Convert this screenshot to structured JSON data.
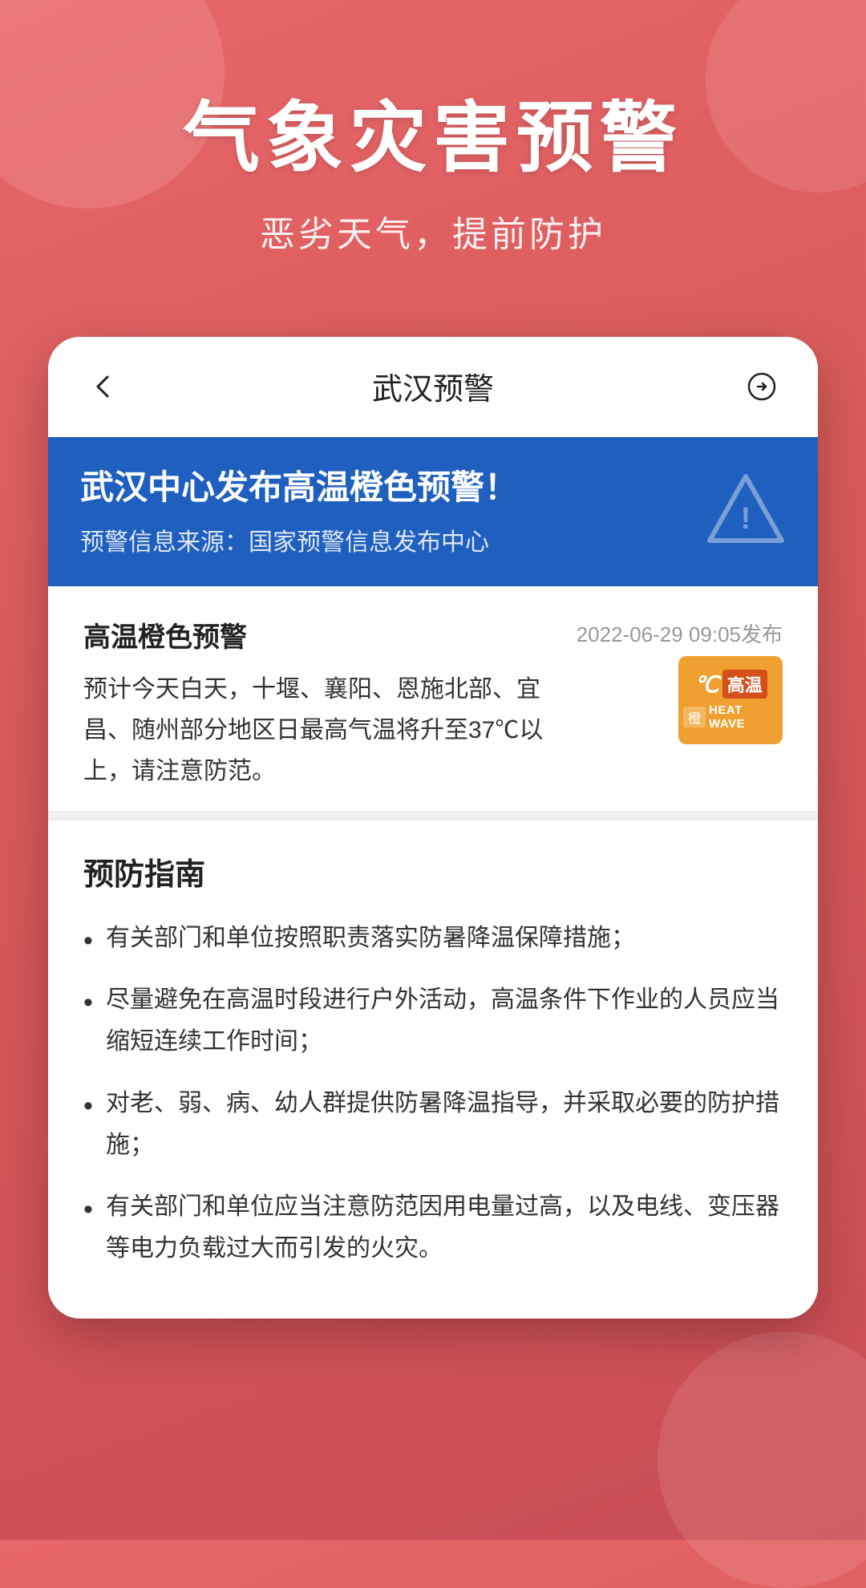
{
  "background": {
    "color": "#d95a5a"
  },
  "header": {
    "main_title": "气象灾害预警",
    "sub_title": "恶劣天气，提前防护"
  },
  "topbar": {
    "back_label": "<",
    "title": "武汉预警",
    "share_label": "share"
  },
  "alert_banner": {
    "title": "武汉中心发布高温橙色预警！",
    "source_label": "预警信息来源：国家预警信息发布中心"
  },
  "alert_detail": {
    "type": "高温橙色预警",
    "timestamp": "2022-06-29 09:05发布",
    "description": "预计今天白天，十堰、襄阳、恩施北部、宜昌、随州部分地区日最高气温将升至37℃以上，请注意防范。",
    "badge": {
      "celsius": "℃",
      "high_temp_label": "高温",
      "level_label": "橙",
      "heat_wave_label": "HEAT WAVE"
    }
  },
  "guide": {
    "title": "预防指南",
    "items": [
      "有关部门和单位按照职责落实防暑降温保障措施；",
      "尽量避免在高温时段进行户外活动，高温条件下作业的人员应当缩短连续工作时间；",
      "对老、弱、病、幼人群提供防暑降温指导，并采取必要的防护措施；",
      "有关部门和单位应当注意防范因用电量过高，以及电线、变压器等电力负载过大而引发的火灾。"
    ]
  }
}
